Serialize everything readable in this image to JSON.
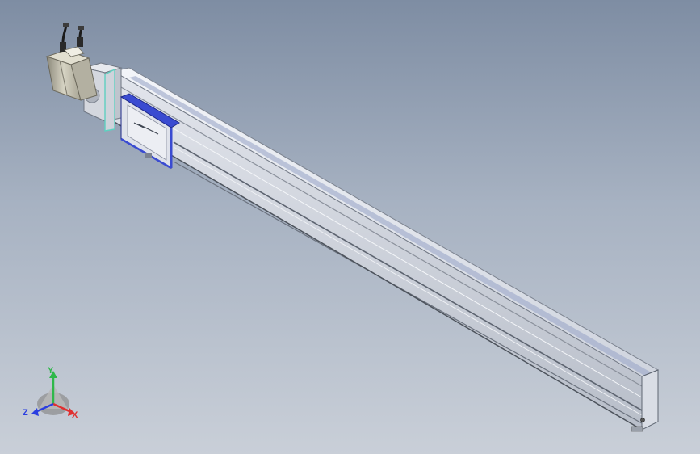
{
  "viewport": {
    "background_top": "#7e8da3",
    "background_bottom": "#c9cfd8"
  },
  "model": {
    "name": "",
    "colors": {
      "rail": "#d7dbe4",
      "rail_light": "#eef1f6",
      "rail_dark": "#9aa1ad",
      "carriage_accent": "#3a4bd1",
      "motor": "#c8c5b6",
      "cable": "#1b1b1b"
    }
  },
  "triad": {
    "x_label": "X",
    "y_label": "Y",
    "z_label": "Z",
    "x_color": "#e03030",
    "y_color": "#2fb84a",
    "z_color": "#2a3ee0"
  }
}
